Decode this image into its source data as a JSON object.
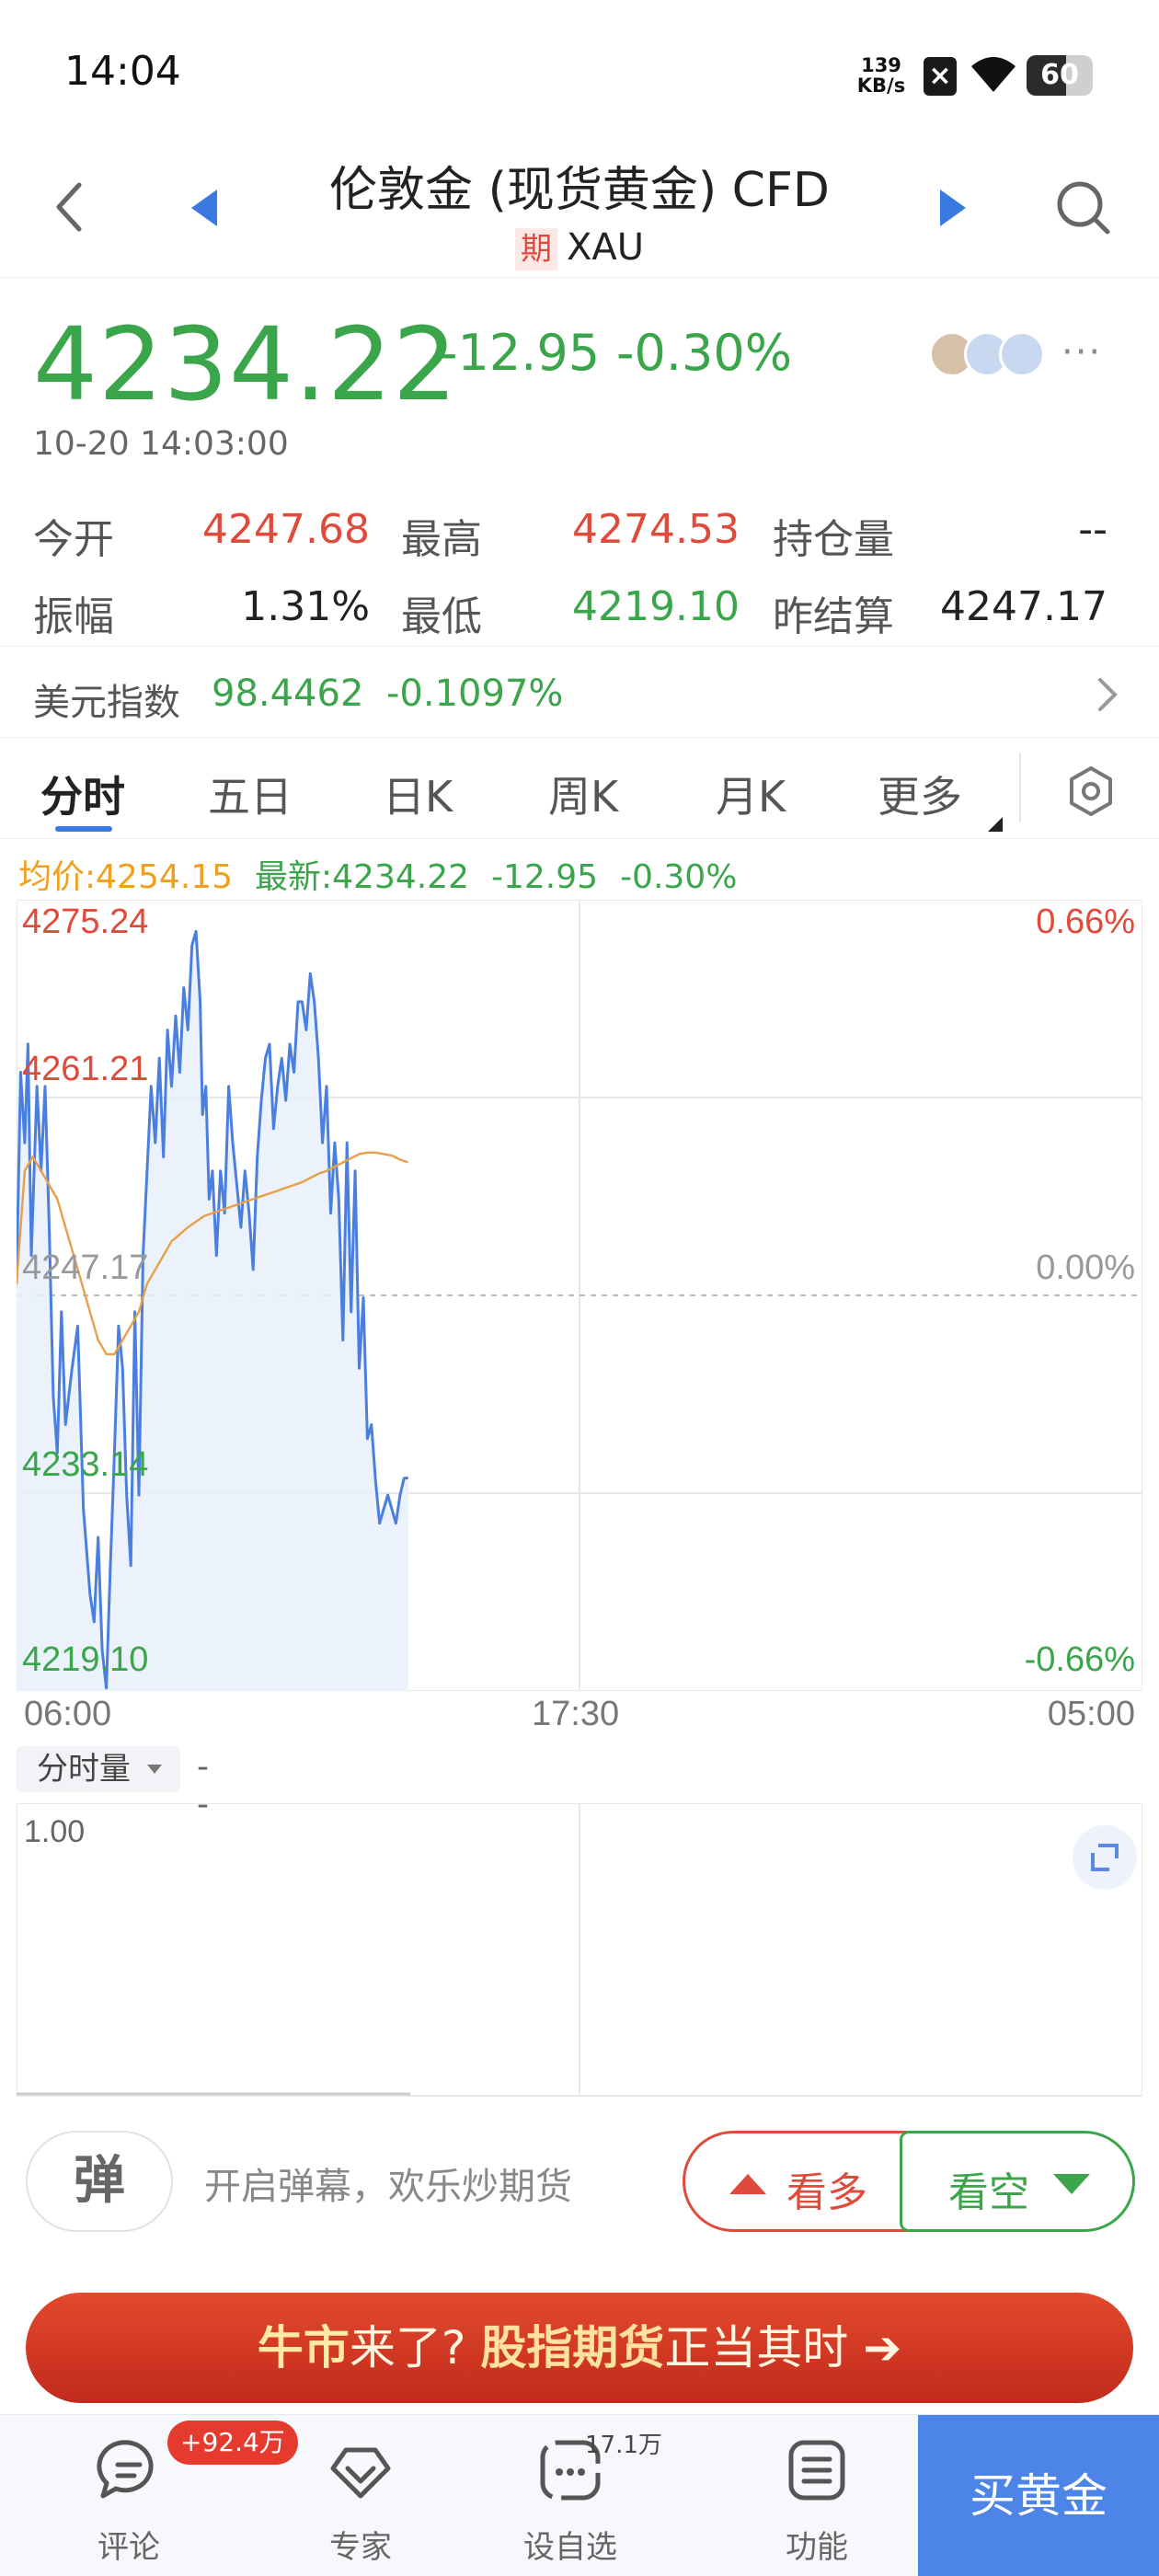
{
  "status_bar": {
    "time": "14:04",
    "net_speed_value": "139",
    "net_speed_unit": "KB/s",
    "battery": "60",
    "battery_level": 0.6
  },
  "header": {
    "title": "伦敦金 (现货黄金) CFD",
    "tag": "期",
    "code": "XAU"
  },
  "quote": {
    "price": "4234.22",
    "change": "-12.95",
    "change_pct": "-0.30%",
    "datetime": "10-20 14:03:00"
  },
  "stats": {
    "open_label": "今开",
    "open_value": "4247.68",
    "high_label": "最高",
    "high_value": "4274.53",
    "oi_label": "持仓量",
    "oi_value": "--",
    "amp_label": "振幅",
    "amp_value": "1.31%",
    "low_label": "最低",
    "low_value": "4219.10",
    "settle_label": "昨结算",
    "settle_value": "4247.17"
  },
  "usd_index": {
    "label": "美元指数",
    "value": "98.4462",
    "change": "-0.1097%"
  },
  "tabs": [
    "分时",
    "五日",
    "日K",
    "周K",
    "月K",
    "更多"
  ],
  "legend": {
    "avg": "均价:4254.15",
    "last": "最新:4234.22",
    "change": "-12.95",
    "pct": "-0.30%"
  },
  "chart_data": {
    "type": "line",
    "title": "",
    "y_tick_labels": [
      "4275.24",
      "4261.21",
      "4247.17",
      "4233.14",
      "4219.10"
    ],
    "right_tick_labels": [
      "0.66%",
      "0.00%",
      "-0.66%"
    ],
    "x_tick_labels": [
      "06:00",
      "17:30",
      "05:00"
    ],
    "ylim": [
      4219.1,
      4275.24
    ],
    "reference": 4247.17,
    "x_range": [
      0,
      1380
    ],
    "x_unit": "minutes since 06:00",
    "series": [
      {
        "role": "price",
        "color": "#4a7fe0",
        "x": [
          0,
          5,
          10,
          14,
          18,
          25,
          30,
          35,
          40,
          45,
          50,
          55,
          60,
          68,
          75,
          82,
          90,
          95,
          100,
          105,
          110,
          115,
          120,
          125,
          130,
          135,
          140,
          145,
          150,
          155,
          160,
          165,
          170,
          175,
          180,
          185,
          190,
          195,
          200,
          205,
          210,
          215,
          220,
          225,
          228,
          232,
          236,
          240,
          245,
          250,
          255,
          260,
          265,
          270,
          275,
          280,
          285,
          290,
          295,
          300,
          305,
          310,
          315,
          320,
          325,
          330,
          335,
          340,
          345,
          350,
          355,
          360,
          365,
          370,
          375,
          380,
          385,
          390,
          395,
          400,
          405,
          410,
          415,
          420,
          425,
          430,
          435,
          440,
          445,
          450,
          455,
          460,
          465,
          470,
          475,
          480
        ],
        "y": [
          4248,
          4263,
          4258,
          4265,
          4250,
          4262,
          4256,
          4262,
          4252,
          4240,
          4236,
          4246,
          4238,
          4242,
          4245,
          4232,
          4226,
          4224,
          4230,
          4222,
          4219.3,
          4228,
          4236,
          4245,
          4242,
          4233,
          4228,
          4246,
          4233,
          4250,
          4256,
          4262,
          4258,
          4264,
          4257,
          4266,
          4262,
          4267,
          4263,
          4269,
          4266,
          4272,
          4273,
          4268,
          4260,
          4262,
          4254,
          4256,
          4250,
          4256,
          4253,
          4262,
          4258,
          4255,
          4252,
          4256,
          4253,
          4249,
          4257,
          4261,
          4264,
          4265,
          4259,
          4262,
          4264,
          4261,
          4265,
          4263,
          4268,
          4268,
          4266,
          4270,
          4268,
          4264,
          4258,
          4262,
          4253,
          4258,
          4254,
          4244,
          4258,
          4246,
          4256,
          4242,
          4247,
          4237,
          4238,
          4234,
          4231,
          4232,
          4233,
          4232,
          4231,
          4233,
          4234.2,
          4234.22
        ],
        "fill": true
      },
      {
        "role": "average",
        "color": "#e8a048",
        "x": [
          0,
          10,
          20,
          30,
          40,
          50,
          60,
          70,
          80,
          90,
          100,
          110,
          120,
          130,
          140,
          150,
          160,
          170,
          180,
          190,
          200,
          210,
          220,
          230,
          240,
          250,
          260,
          270,
          280,
          290,
          300,
          310,
          320,
          330,
          340,
          350,
          360,
          370,
          380,
          390,
          400,
          410,
          420,
          430,
          440,
          450,
          460,
          470,
          480
        ],
        "y": [
          4248,
          4256,
          4257,
          4256,
          4255,
          4254,
          4252,
          4250,
          4248,
          4246,
          4244,
          4243,
          4243,
          4244,
          4245,
          4246,
          4248,
          4249,
          4250,
          4251,
          4251.5,
          4252,
          4252.4,
          4252.8,
          4253,
          4253.2,
          4253.4,
          4253.6,
          4253.8,
          4254,
          4254.2,
          4254.4,
          4254.6,
          4254.8,
          4255,
          4255.2,
          4255.5,
          4255.8,
          4256,
          4256.3,
          4256.6,
          4256.9,
          4257.2,
          4257.3,
          4257.3,
          4257.2,
          4257.1,
          4256.8,
          4256.6
        ]
      }
    ],
    "grid": true
  },
  "volume": {
    "selector_label": "分时量",
    "value": "--",
    "axis_label": "1.00"
  },
  "actions": {
    "danmu_icon_text": "弹",
    "danmu_tip": "开启弹幕，欢乐炒期货",
    "bull_label": "看多",
    "bear_label": "看空"
  },
  "banner": {
    "part1": "牛市",
    "part2": "来了? ",
    "part3": "股指期货",
    "part4": "正当其时 ➔"
  },
  "bottom_nav": {
    "comment_label": "评论",
    "comment_badge": "+92.4万",
    "expert_label": "专家",
    "watch_label": "设自选",
    "watch_count": "17.1万",
    "func_label": "功能",
    "buy_label": "买黄金"
  },
  "colors": {
    "up": "#e04a3a",
    "down": "#3aa54a",
    "accent": "#3a7ae0",
    "avg_line": "#f0a020"
  }
}
